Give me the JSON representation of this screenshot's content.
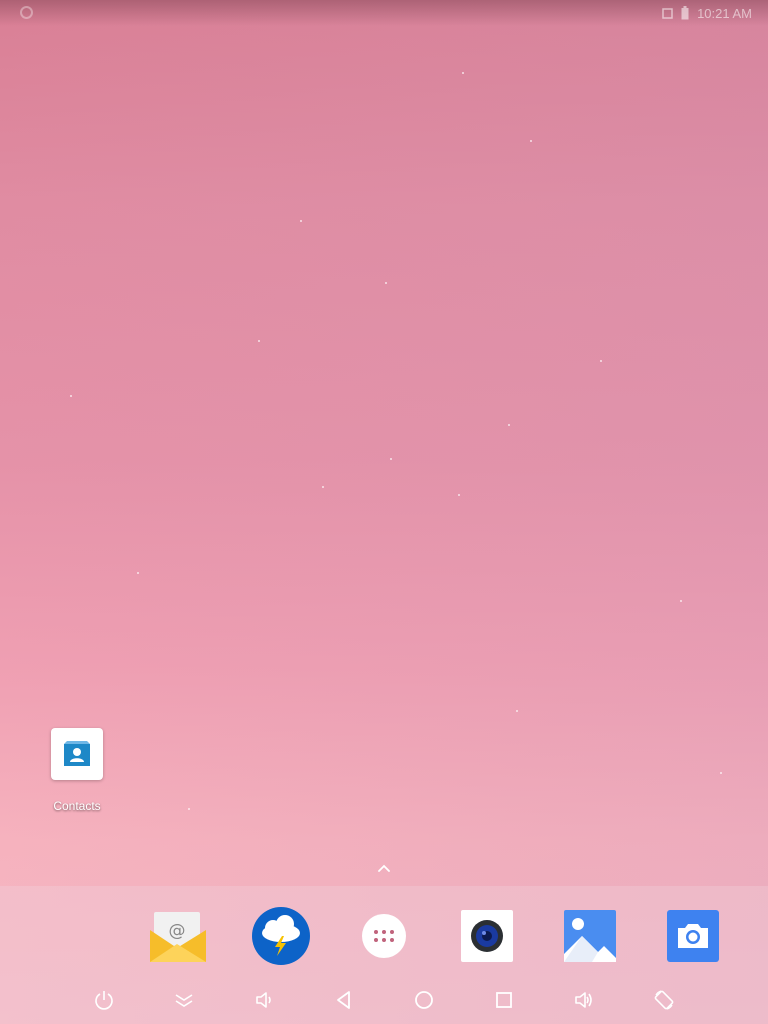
{
  "status_bar": {
    "time": "10:21 AM",
    "icons": [
      "notification-dot-icon",
      "signal-icon",
      "battery-icon"
    ]
  },
  "desktop": {
    "shortcuts": [
      {
        "label": "Contacts",
        "icon": "contacts-icon",
        "color": "#1e88c7"
      }
    ]
  },
  "dock": {
    "drawer_handle_icon": "chevron-up-icon",
    "apps": [
      {
        "icon": "email-icon"
      },
      {
        "icon": "weather-storm-icon"
      },
      {
        "icon": "app-drawer-icon"
      },
      {
        "icon": "music-speaker-icon"
      },
      {
        "icon": "gallery-icon"
      },
      {
        "icon": "camera-icon"
      }
    ]
  },
  "navigation_bar": {
    "buttons": [
      "power-icon",
      "collapse-icon",
      "volume-down-icon",
      "back-icon",
      "home-icon",
      "recents-icon",
      "volume-up-icon",
      "rotate-icon"
    ]
  },
  "colors": {
    "accent_blue": "#1e88c7",
    "email_yellow": "#f6bd2a",
    "camera_blue": "#3e82f0"
  }
}
